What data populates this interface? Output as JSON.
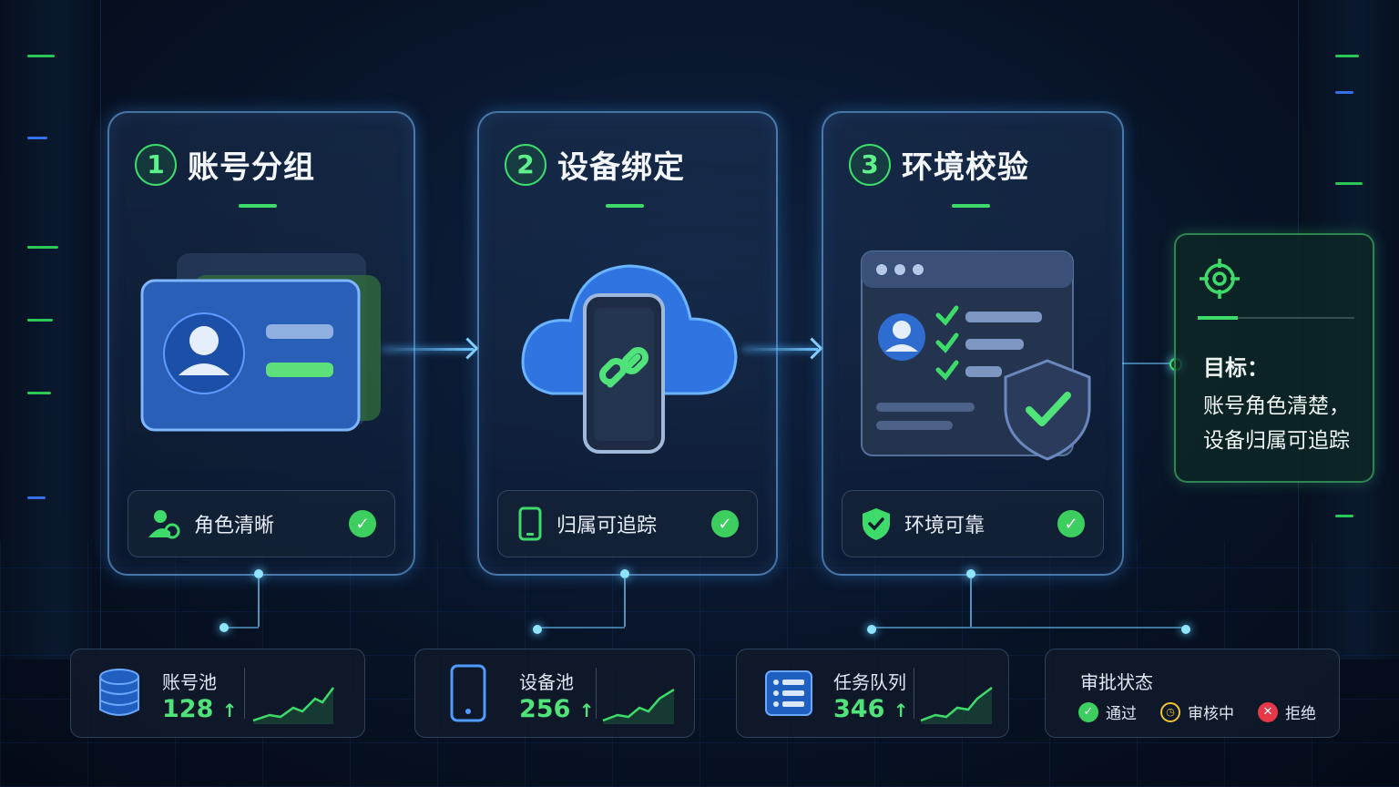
{
  "steps": [
    {
      "num": "1",
      "title": "账号分组",
      "badge": "角色清晰"
    },
    {
      "num": "2",
      "title": "设备绑定",
      "badge": "归属可追踪"
    },
    {
      "num": "3",
      "title": "环境校验",
      "badge": "环境可靠"
    }
  ],
  "goal": {
    "heading": "目标：",
    "line1": "账号角色清楚，",
    "line2": "设备归属可追踪"
  },
  "stats": [
    {
      "label": "账号池",
      "value": "128",
      "trend": "↑"
    },
    {
      "label": "设备池",
      "value": "256",
      "trend": "↑"
    },
    {
      "label": "任务队列",
      "value": "346",
      "trend": "↑"
    }
  ],
  "approval": {
    "label": "审批状态",
    "items": [
      {
        "label": "通过",
        "color": "#3ccf5f",
        "icon": "check-circle-icon"
      },
      {
        "label": "审核中",
        "color": "#f1c232",
        "icon": "clock-icon"
      },
      {
        "label": "拒绝",
        "color": "#e53947",
        "icon": "x-circle-icon"
      }
    ]
  },
  "colors": {
    "accent_green": "#3ddc6a",
    "glow_blue": "#6fc6ff",
    "panel_border": "#78beff"
  }
}
